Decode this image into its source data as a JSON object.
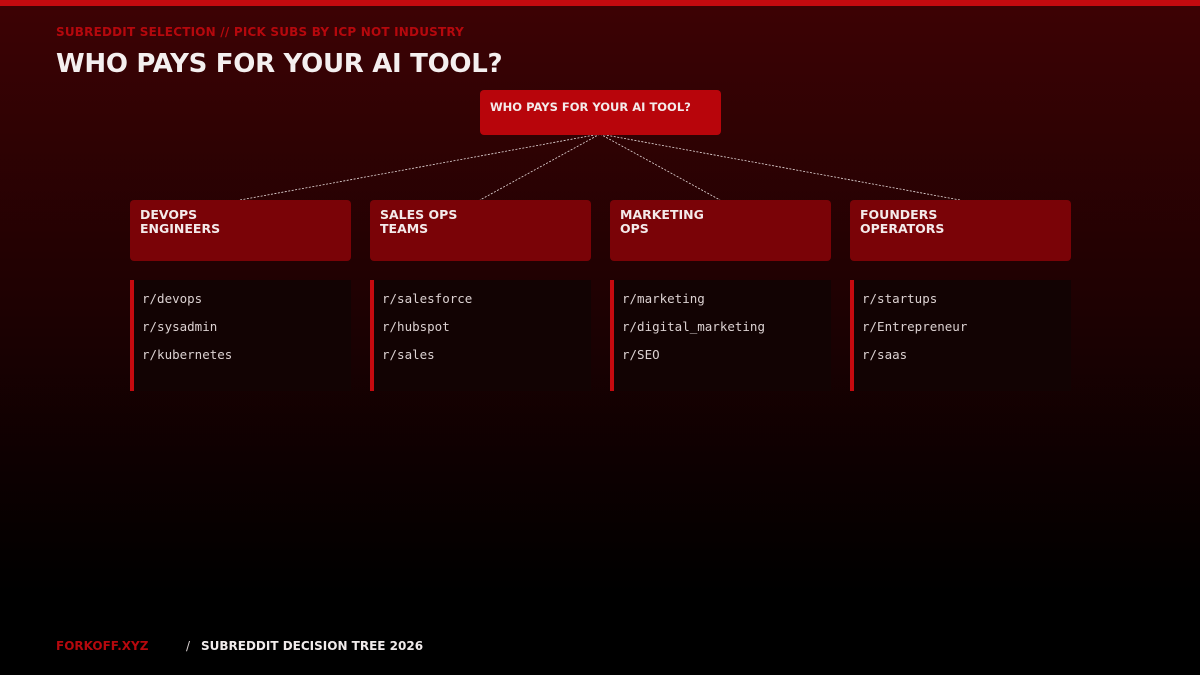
{
  "header": {
    "eyebrow": "SUBREDDIT SELECTION // PICK SUBS BY ICP NOT INDUSTRY",
    "title": "WHO PAYS FOR YOUR AI TOOL?"
  },
  "tree": {
    "root": "WHO PAYS FOR YOUR AI TOOL?",
    "categories": [
      {
        "label": "DEVOPS\nENGINEERS",
        "subs": [
          "r/devops",
          "r/sysadmin",
          "r/kubernetes"
        ]
      },
      {
        "label": "SALES OPS\nTEAMS",
        "subs": [
          "r/salesforce",
          "r/hubspot",
          "r/sales"
        ]
      },
      {
        "label": "MARKETING\nOPS",
        "subs": [
          "r/marketing",
          "r/digital_marketing",
          "r/SEO"
        ]
      },
      {
        "label": "FOUNDERS\nOPERATORS",
        "subs": [
          "r/startups",
          "r/Entrepreneur",
          "r/saas"
        ]
      }
    ]
  },
  "footer": {
    "brand": "FORKOFF.XYZ",
    "separator": "/",
    "caption": "SUBREDDIT DECISION TREE 2026"
  },
  "colors": {
    "accent": "#c40a0f",
    "root_node": "#b8050b",
    "category_card": "#7a0307",
    "list_background": "#120303"
  }
}
